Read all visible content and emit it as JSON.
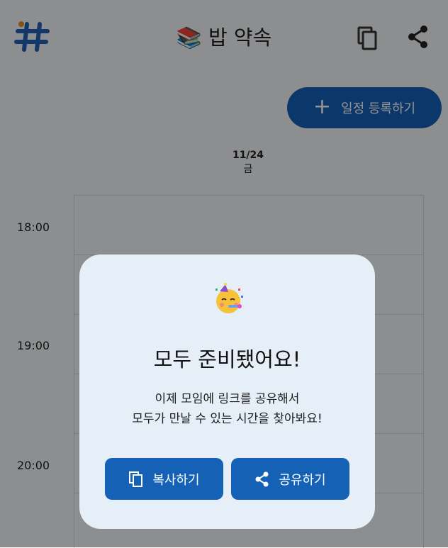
{
  "header": {
    "title": "📚 밥 약속",
    "logo_icon": "hash-icon",
    "copy_icon": "copy-icon",
    "share_icon": "share-icon"
  },
  "schedule": {
    "add_button_label": "일정 등록하기",
    "add_icon": "+",
    "date": "11/24",
    "weekday": "금",
    "times": [
      "18:00",
      "19:00",
      "20:00"
    ]
  },
  "dialog": {
    "emoji_icon": "party-face-emoji",
    "title": "모두 준비됐어요!",
    "message_line1": "이제 모임에 링크를 공유해서",
    "message_line2": "모두가 만날 수 있는 시간을 찾아봐요!",
    "copy_label": "복사하기",
    "share_label": "공유하기"
  },
  "colors": {
    "primary": "#1561b5",
    "logo_blue": "#1f5fb4",
    "logo_orange": "#f08a24",
    "overlay": "rgba(0,0,0,0.42)",
    "dialog_bg": "#e6eef7"
  }
}
